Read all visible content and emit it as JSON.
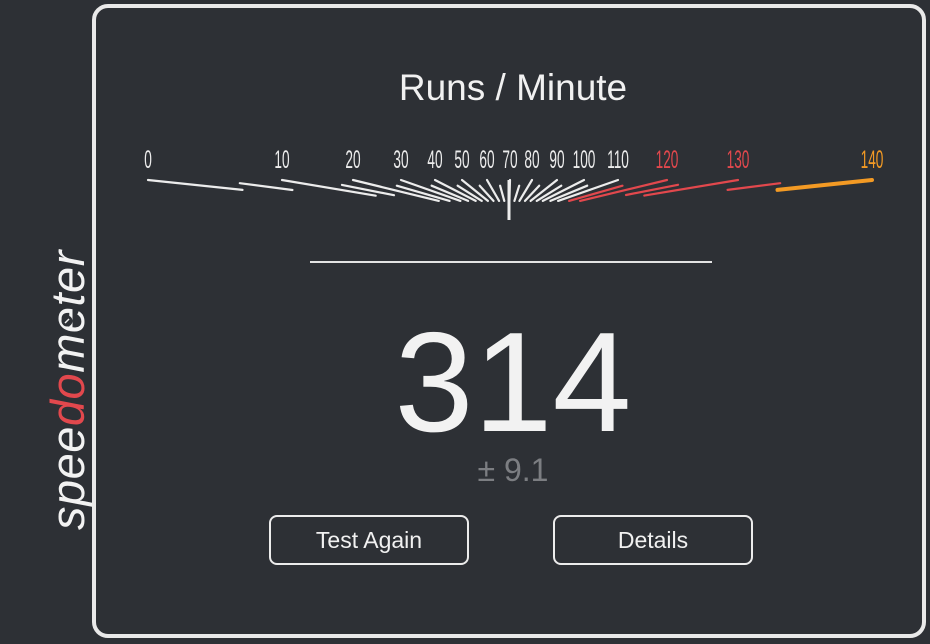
{
  "logo": {
    "part1": "spee",
    "part2": "do",
    "part3": "meter",
    "accent": "#e2484d",
    "text_color": "#f2f2f2"
  },
  "gauge": {
    "title": "Runs / Minute",
    "ticks": [
      {
        "label": "0",
        "zone": "normal"
      },
      {
        "label": "10",
        "zone": "normal"
      },
      {
        "label": "20",
        "zone": "normal"
      },
      {
        "label": "30",
        "zone": "normal"
      },
      {
        "label": "40",
        "zone": "normal"
      },
      {
        "label": "50",
        "zone": "normal"
      },
      {
        "label": "60",
        "zone": "normal"
      },
      {
        "label": "70",
        "zone": "normal"
      },
      {
        "label": "80",
        "zone": "normal"
      },
      {
        "label": "90",
        "zone": "normal"
      },
      {
        "label": "100",
        "zone": "normal"
      },
      {
        "label": "110",
        "zone": "normal"
      },
      {
        "label": "120",
        "zone": "warning"
      },
      {
        "label": "130",
        "zone": "warning"
      },
      {
        "label": "140",
        "zone": "danger"
      }
    ],
    "colors": {
      "normal": "#ececec",
      "warning": "#e2484d",
      "danger": "#f39a24"
    }
  },
  "result": {
    "score": "314",
    "error": "± 9.1"
  },
  "buttons": {
    "test_again": "Test Again",
    "details": "Details"
  }
}
